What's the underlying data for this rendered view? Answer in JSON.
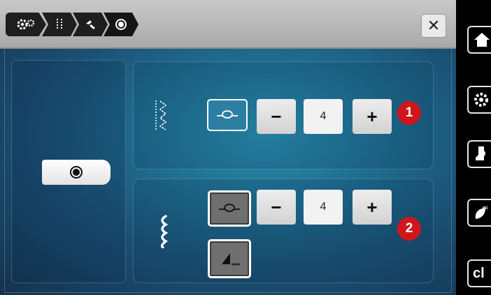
{
  "breadcrumbs": [
    {
      "name": "settings-gears-icon",
      "glyph": "⚙"
    },
    {
      "name": "straight-stitch-icon",
      "glyph": "┆"
    },
    {
      "name": "needle-icon",
      "glyph": "↰"
    },
    {
      "name": "record-icon",
      "glyph": "◉"
    }
  ],
  "close_label": "✕",
  "option_1": {
    "stitch_glyph": "⋮",
    "minus_label": "−",
    "value": "4",
    "plus_label": "+",
    "badge": "1"
  },
  "option_2": {
    "stitch_glyph": "ꜱ",
    "minus_label": "−",
    "value": "4",
    "plus_label": "+",
    "badge": "2"
  },
  "sidebar": {
    "items": [
      {
        "name": "home-icon",
        "label": ""
      },
      {
        "name": "settings-icon",
        "label": ""
      },
      {
        "name": "presser-foot-icon",
        "label": ""
      },
      {
        "name": "eco-icon",
        "label": ""
      },
      {
        "name": "clear-button",
        "label": "cl"
      }
    ]
  },
  "colors": {
    "badge": "#d0161a",
    "background_center": "#2a8fb0",
    "background_edge": "#14324d"
  }
}
